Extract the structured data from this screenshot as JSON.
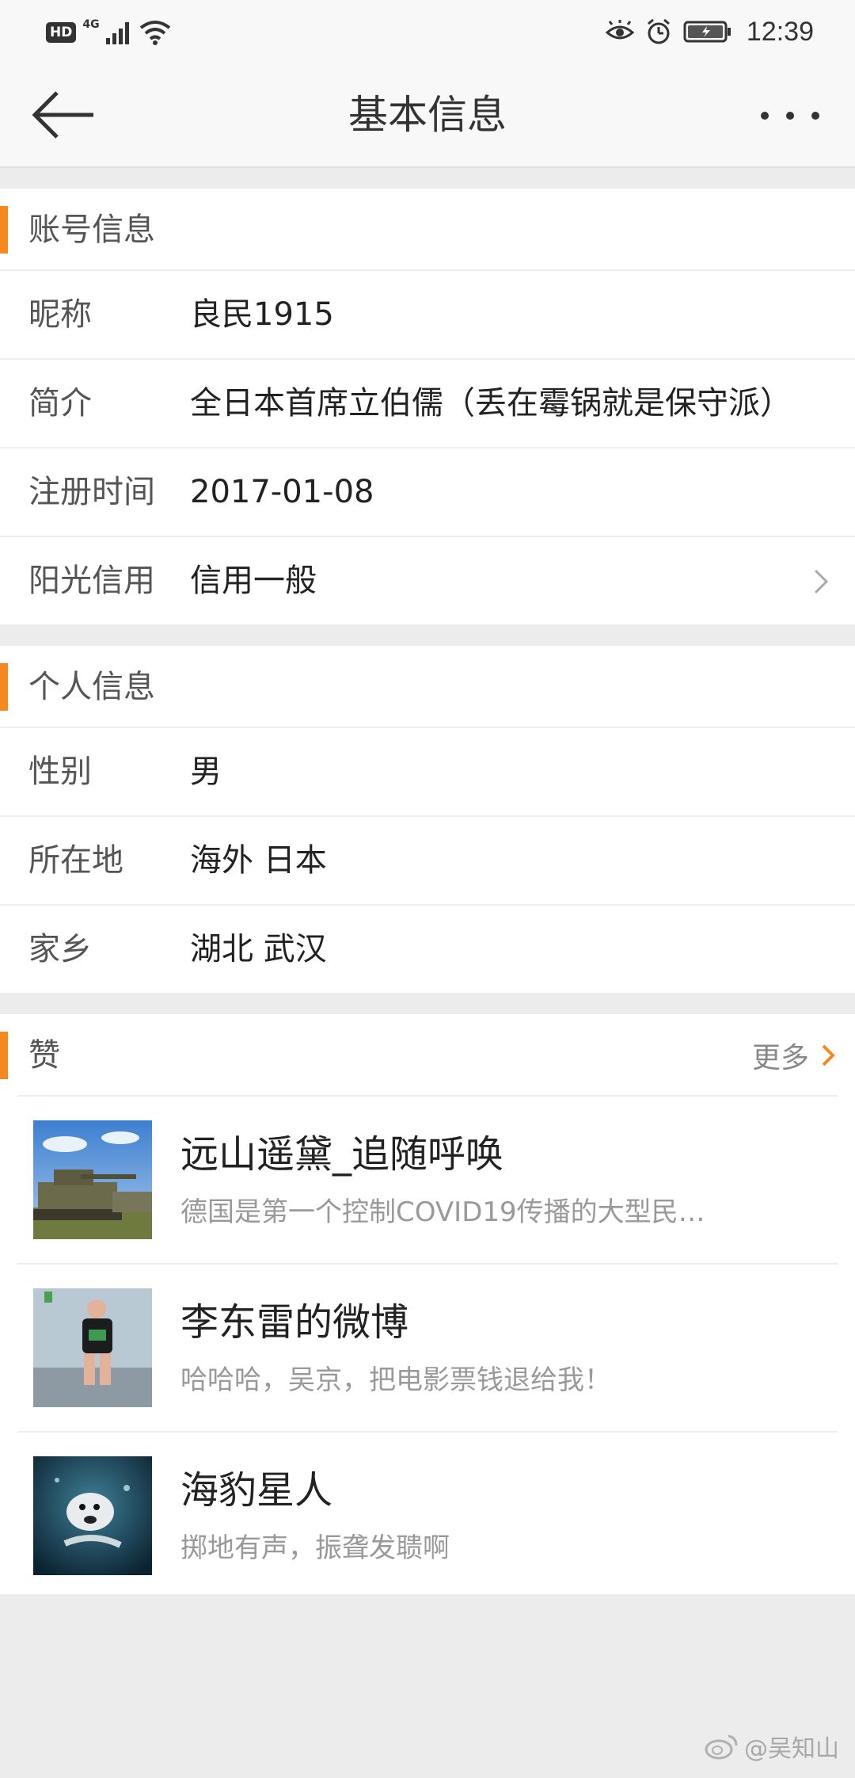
{
  "status_bar": {
    "hd": "HD",
    "network": "4G",
    "time": "12:39"
  },
  "nav": {
    "title": "基本信息"
  },
  "account_section": {
    "title": "账号信息",
    "rows": [
      {
        "label": "昵称",
        "value": "良民1915"
      },
      {
        "label": "简介",
        "value": "全日本首席立伯儒（丢在霉锅就是保守派）"
      },
      {
        "label": "注册时间",
        "value": "2017-01-08"
      },
      {
        "label": "阳光信用",
        "value": "信用一般"
      }
    ]
  },
  "personal_section": {
    "title": "个人信息",
    "rows": [
      {
        "label": "性别",
        "value": "男"
      },
      {
        "label": "所在地",
        "value": "海外 日本"
      },
      {
        "label": "家乡",
        "value": "湖北 武汉"
      }
    ]
  },
  "likes_section": {
    "title": "赞",
    "more_label": "更多",
    "items": [
      {
        "title": "远山遥黛_追随呼唤",
        "subtitle": "德国是第一个控制COVID19传播的大型民…"
      },
      {
        "title": "李东雷的微博",
        "subtitle": "哈哈哈，吴京，把电影票钱退给我！"
      },
      {
        "title": "海豹星人",
        "subtitle": "掷地有声，振聋发聩啊"
      }
    ]
  },
  "watermark": {
    "text": "@吴知山"
  },
  "colors": {
    "accent": "#f5891f",
    "background": "#ececec",
    "card": "#ffffff"
  }
}
